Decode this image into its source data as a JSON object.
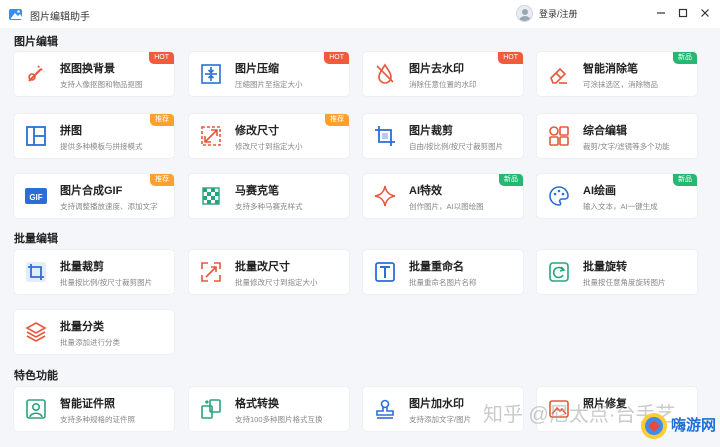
{
  "app": {
    "title": "图片编辑助手",
    "login_label": "登录/注册"
  },
  "sections": [
    {
      "title": "图片编辑"
    },
    {
      "title": "批量编辑"
    },
    {
      "title": "特色功能"
    }
  ],
  "cards": {
    "matting": {
      "name": "抠图换背景",
      "desc": "支持人像抠图和物品抠图",
      "badge": "HOT"
    },
    "compress": {
      "name": "图片压缩",
      "desc": "压缩图片至指定大小",
      "badge": "HOT"
    },
    "remove_watermark": {
      "name": "图片去水印",
      "desc": "消除任意位置的水印",
      "badge": "HOT"
    },
    "smart_eraser": {
      "name": "智能消除笔",
      "desc": "可涂抹选区，消除物品",
      "badge": "新品"
    },
    "collage": {
      "name": "拼图",
      "desc": "提供多种模板与拼接模式",
      "badge": "推荐"
    },
    "resize": {
      "name": "修改尺寸",
      "desc": "修改尺寸到指定大小",
      "badge": "推荐"
    },
    "crop": {
      "name": "图片裁剪",
      "desc": "自由/按比例/按尺寸裁剪图片",
      "badge": ""
    },
    "comprehensive": {
      "name": "综合编辑",
      "desc": "裁剪/文字/滤镜等多个功能",
      "badge": ""
    },
    "gif": {
      "name": "图片合成GIF",
      "desc": "支持调整播放速度、添加文字",
      "badge": "推荐"
    },
    "mosaic": {
      "name": "马赛克笔",
      "desc": "支持多种马赛克样式",
      "badge": ""
    },
    "ai_effects": {
      "name": "AI特效",
      "desc": "创作图片，AI以图绘图",
      "badge": "新品"
    },
    "ai_paint": {
      "name": "AI绘画",
      "desc": "输入文本，AI一键生成",
      "badge": "新品"
    },
    "batch_crop": {
      "name": "批量裁剪",
      "desc": "批量按比例/按尺寸裁剪图片",
      "badge": ""
    },
    "batch_resize": {
      "name": "批量改尺寸",
      "desc": "批量修改尺寸到指定大小",
      "badge": ""
    },
    "batch_rename": {
      "name": "批量重命名",
      "desc": "批量重命名图片名称",
      "badge": ""
    },
    "batch_rotate": {
      "name": "批量旋转",
      "desc": "批量按任意角度旋转图片",
      "badge": ""
    },
    "batch_classify": {
      "name": "批量分类",
      "desc": "批量添加进行分类",
      "badge": ""
    },
    "id_photo": {
      "name": "智能证件照",
      "desc": "支持多种规格的证件照",
      "badge": ""
    },
    "format": {
      "name": "格式转换",
      "desc": "支持100多种图片格式互换",
      "badge": ""
    },
    "add_watermark": {
      "name": "图片加水印",
      "desc": "支持添加文字/图片",
      "badge": ""
    },
    "photo_repair": {
      "name": "照片修复",
      "desc": "",
      "badge": ""
    }
  },
  "watermark_text": "知乎 @尼太点·台手艺",
  "corner_logo_text": "嗨游网",
  "colors": {
    "accent": "#2a6fd6",
    "hot": "#f15a3a",
    "recommend": "#ff9f2e",
    "new": "#27b773",
    "icon_red": "#e8563b",
    "icon_blue": "#2a6fd6"
  }
}
